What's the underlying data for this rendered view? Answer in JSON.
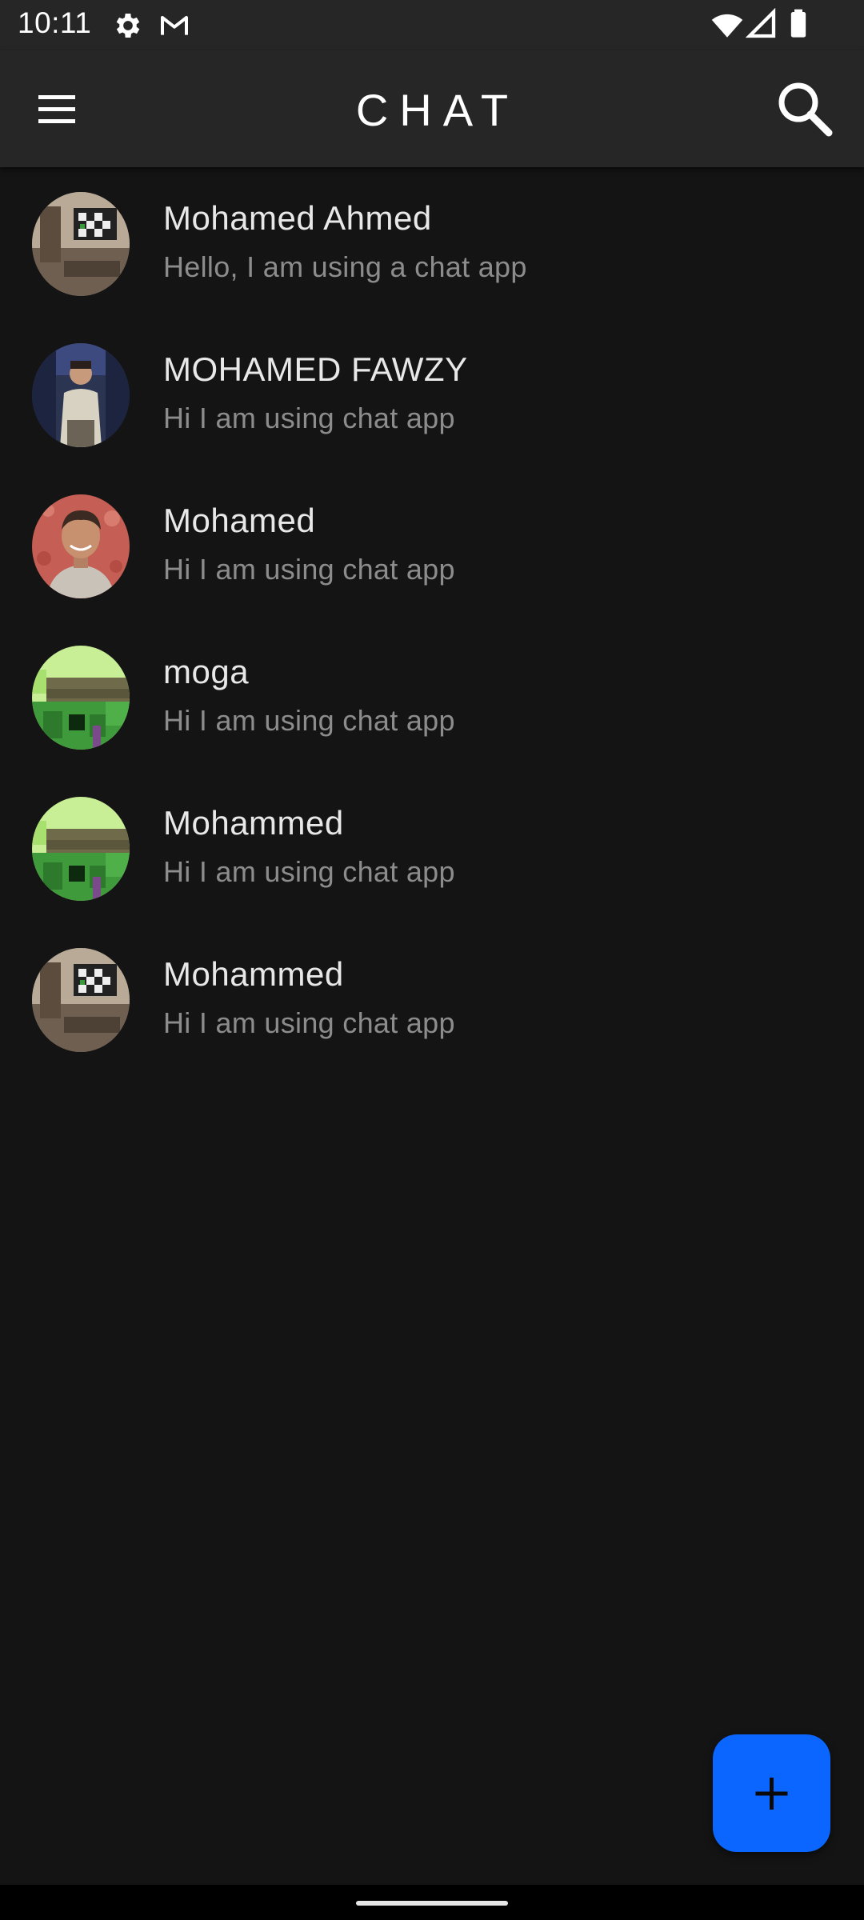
{
  "status_bar": {
    "time": "10:11",
    "left_icons": [
      "settings-gear-icon",
      "gmail-icon"
    ],
    "right_icons": [
      "wifi-icon",
      "cellular-signal-icon",
      "battery-icon"
    ]
  },
  "app_bar": {
    "title": "CHAT",
    "menu_icon": "hamburger-menu-icon",
    "search_icon": "search-icon"
  },
  "chats": [
    {
      "name": "Mohamed Ahmed",
      "status": "Hello, I am using a chat app",
      "avatar": "room-photo"
    },
    {
      "name": "MOHAMED FAWZY",
      "status": "Hi I am using chat app",
      "avatar": "man-in-suit-photo"
    },
    {
      "name": "Mohamed",
      "status": "Hi I am using chat app",
      "avatar": "smiling-man-photo"
    },
    {
      "name": "moga",
      "status": "Hi I am using chat app",
      "avatar": "green-pixel-art"
    },
    {
      "name": "Mohammed",
      "status": "Hi I am using chat app",
      "avatar": "green-pixel-art"
    },
    {
      "name": "Mohammed",
      "status": "Hi I am using chat app",
      "avatar": "room-photo"
    }
  ],
  "fab": {
    "icon": "plus-icon"
  },
  "colors": {
    "background": "#141414",
    "app_bar": "#262626",
    "accent": "#0a66ff",
    "secondary_text": "#8c8c8c"
  }
}
